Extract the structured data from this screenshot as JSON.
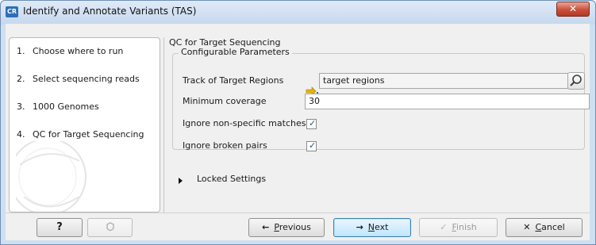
{
  "window": {
    "app_icon": "CR",
    "title": "Identify and Annotate Variants (TAS)",
    "close_glyph": "✕"
  },
  "steps": [
    {
      "number": "1.",
      "label": "Choose where to run"
    },
    {
      "number": "2.",
      "label": "Select sequencing reads"
    },
    {
      "number": "3.",
      "label": "1000 Genomes"
    },
    {
      "number": "4.",
      "label": "QC for Target Sequencing"
    }
  ],
  "panel": {
    "section_title": "QC for Target Sequencing",
    "group_title": "Configurable Parameters",
    "track_label": "Track of Target Regions",
    "track_value": "target regions",
    "min_coverage_label": "Minimum coverage",
    "min_coverage_value": "30",
    "ignore_nonspecific_label": "Ignore non-specific matches",
    "ignore_nonspecific_checked": true,
    "ignore_broken_label": "Ignore broken pairs",
    "ignore_broken_checked": true,
    "locked_label": "Locked Settings"
  },
  "buttons": {
    "help": "?",
    "previous": {
      "icon": "←",
      "mnemonic": "P",
      "rest": "revious"
    },
    "next": {
      "icon": "→",
      "mnemonic": "N",
      "rest": "ext"
    },
    "finish": {
      "icon": "✓",
      "mnemonic": "F",
      "rest": "inish"
    },
    "cancel": {
      "icon": "✕",
      "mnemonic": "C",
      "rest": "ancel"
    }
  },
  "icons": {
    "close": "close-icon",
    "track": "track-icon",
    "browse": "browse-icon",
    "help": "help-icon",
    "restore": "restore-icon"
  },
  "colors": {
    "title_bar": "#c6d8ee",
    "close_button": "#c9503b",
    "default_button": "#bee6fd",
    "checkbox_tick": "#2b4f8a"
  }
}
